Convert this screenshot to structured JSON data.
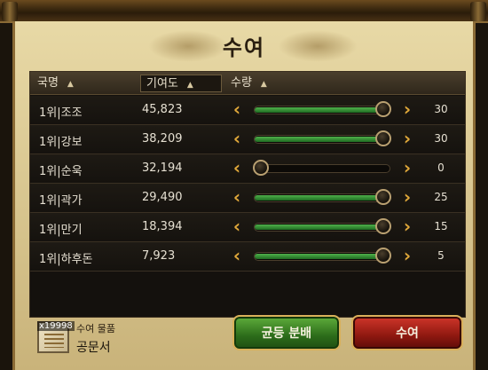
{
  "title": "수여",
  "headers": {
    "name": "국명",
    "contribution": "기여도",
    "quantity": "수량",
    "sort_arrow": "▲"
  },
  "rows": [
    {
      "name": "1위|조조",
      "contribution": "45,823",
      "quantity": "30",
      "level": 1.0
    },
    {
      "name": "1위|강보",
      "contribution": "38,209",
      "quantity": "30",
      "level": 1.0
    },
    {
      "name": "1위|순욱",
      "contribution": "32,194",
      "quantity": "0",
      "level": 0.0
    },
    {
      "name": "1위|곽가",
      "contribution": "29,490",
      "quantity": "25",
      "level": 1.0
    },
    {
      "name": "1위|만기",
      "contribution": "18,394",
      "quantity": "15",
      "level": 1.0
    },
    {
      "name": "1위|하후돈",
      "contribution": "7,923",
      "quantity": "5",
      "level": 1.0
    }
  ],
  "controls": {
    "decrease": "‹",
    "increase": "›"
  },
  "reward": {
    "label": "수여 물품",
    "item_name": "공문서",
    "count": "x19998"
  },
  "buttons": {
    "even_split": "균등 분배",
    "give": "수여"
  },
  "colors": {
    "slider_fill": "#2f8a2e",
    "arrow": "#e0a83a",
    "even_button": "#2c6c1a",
    "give_button": "#8e1810"
  }
}
